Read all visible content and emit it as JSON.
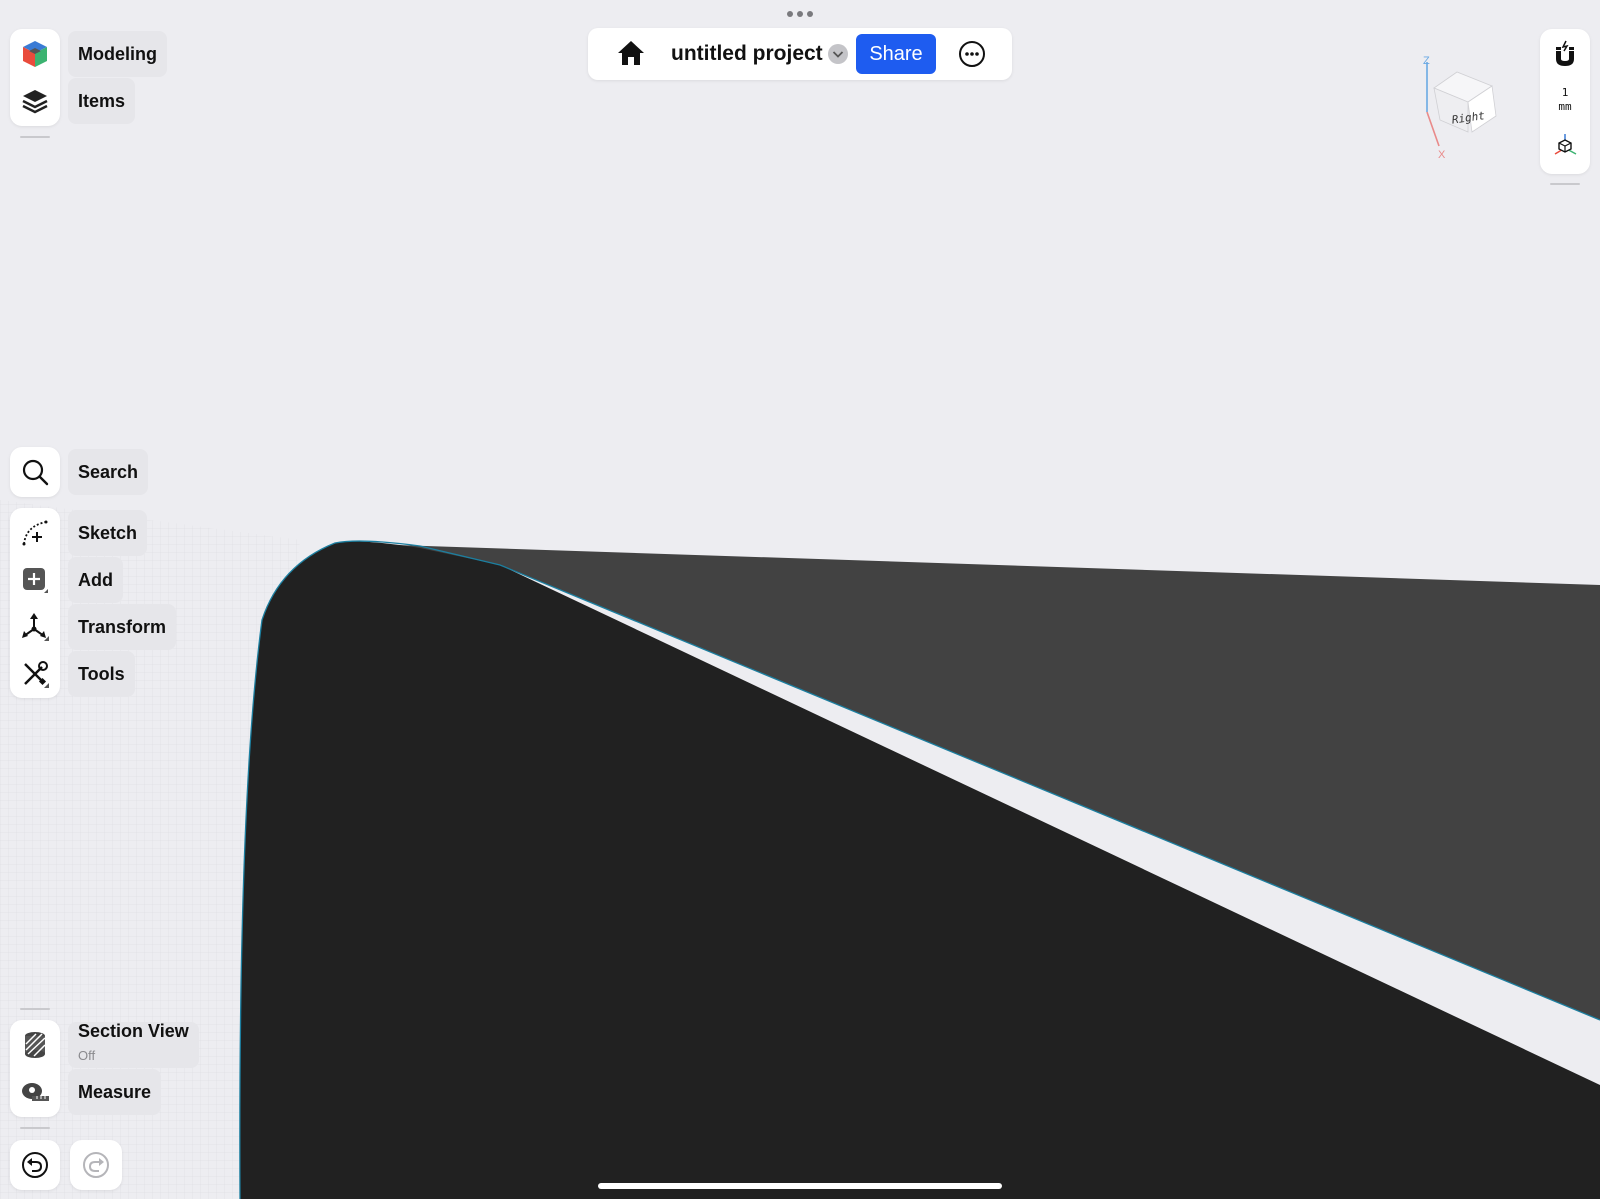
{
  "topbar": {
    "title": "untitled project",
    "share_label": "Share"
  },
  "workspace": {
    "modeling_label": "Modeling",
    "items_label": "Items"
  },
  "tools": {
    "search_label": "Search",
    "sketch_label": "Sketch",
    "add_label": "Add",
    "transform_label": "Transform",
    "tools_label": "Tools"
  },
  "bottom": {
    "section_view_label": "Section View",
    "section_view_state": "Off",
    "measure_label": "Measure"
  },
  "right_panel": {
    "grid_value": "1",
    "grid_unit": "mm"
  },
  "view_cube": {
    "face_label": "Right",
    "axis_z": "Z",
    "axis_x": "X"
  },
  "colors": {
    "background": "#ededf1",
    "shape_dark": "#212121",
    "shape_mid": "#424242",
    "edge_highlight": "#1c7fa0",
    "accent": "#1e5cf0"
  }
}
